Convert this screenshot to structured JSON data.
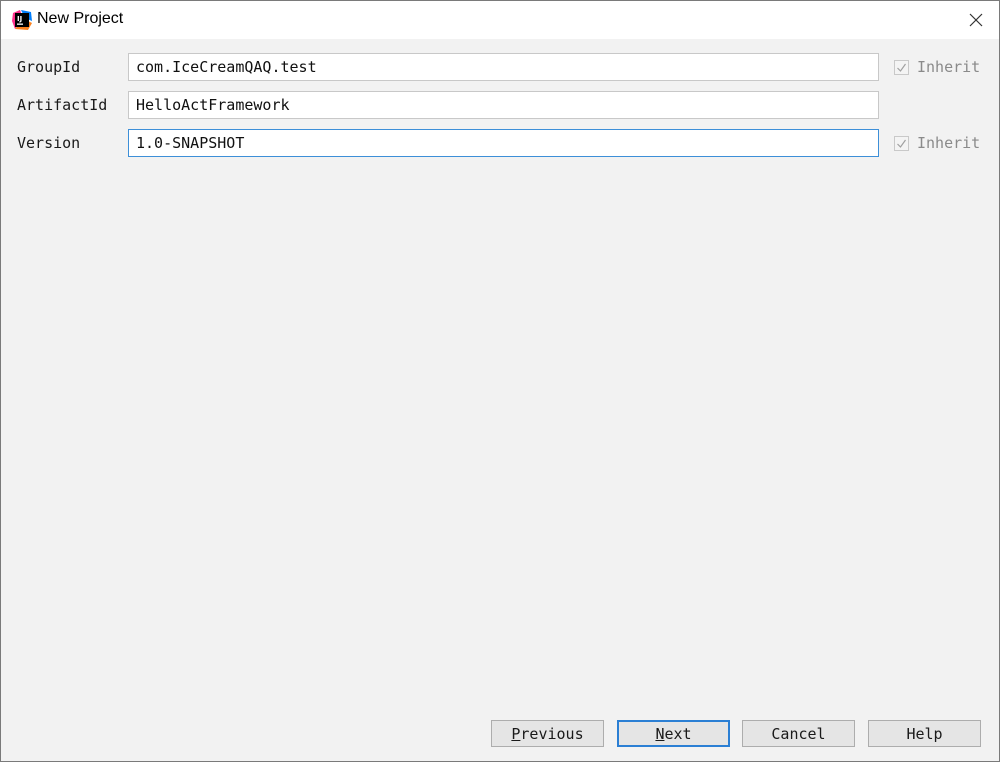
{
  "window": {
    "title": "New Project",
    "app_icon": "intellij-idea-icon",
    "close_icon": "close-icon"
  },
  "form": {
    "fields": [
      {
        "label": "GroupId",
        "value": "com.IceCreamQAQ.test",
        "inherit": {
          "shown": true,
          "checked": true,
          "label": "Inherit"
        }
      },
      {
        "label": "ArtifactId",
        "value": "HelloActFramework",
        "inherit": {
          "shown": false
        }
      },
      {
        "label": "Version",
        "value": "1.0-SNAPSHOT",
        "focused": true,
        "inherit": {
          "shown": true,
          "checked": true,
          "label": "Inherit"
        }
      }
    ]
  },
  "buttons": {
    "previous": {
      "mnemonic": "P",
      "rest": "revious"
    },
    "next": {
      "mnemonic": "N",
      "rest": "ext"
    },
    "cancel": "Cancel",
    "help": "Help"
  },
  "colors": {
    "focus_border": "#2b7fd4",
    "background": "#f2f2f2"
  }
}
